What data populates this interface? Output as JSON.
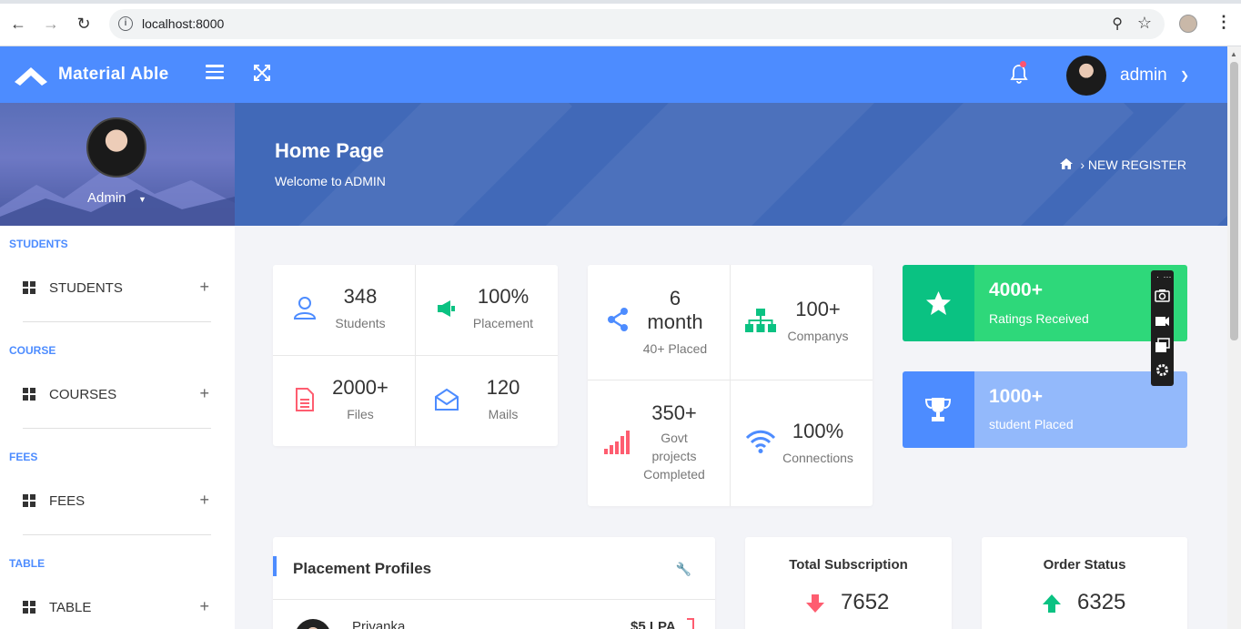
{
  "browser": {
    "url": "localhost:8000",
    "back_icon": "arrow-left-icon",
    "forward_icon": "arrow-right-icon",
    "reload_icon": "reload-icon"
  },
  "header": {
    "brand": "Material Able",
    "user_name": "admin"
  },
  "sidebar": {
    "profile_name": "Admin",
    "sections": [
      {
        "title": "STUDENTS",
        "item": "STUDENTS"
      },
      {
        "title": "COURSE",
        "item": "COURSES"
      },
      {
        "title": "FEES",
        "item": "FEES"
      },
      {
        "title": "TABLE",
        "item": "TABLE"
      }
    ]
  },
  "banner": {
    "title": "Home Page",
    "subtitle": "Welcome to ADMIN",
    "breadcrumb": "NEW REGISTER"
  },
  "stats1": [
    {
      "value": "348",
      "label": "Students",
      "icon": "user-icon",
      "color": "#4d8cff"
    },
    {
      "value": "100%",
      "label": "Placement",
      "icon": "megaphone-icon",
      "color": "#0ac282"
    },
    {
      "value": "2000+",
      "label": "Files",
      "icon": "file-icon",
      "color": "#fe5d70"
    },
    {
      "value": "120",
      "label": "Mails",
      "icon": "envelope-open-icon",
      "color": "#4d8cff"
    }
  ],
  "stats2": [
    {
      "value_line1": "6",
      "value_line2": "month",
      "label": "40+ Placed",
      "icon": "share-icon",
      "color": "#4d8cff"
    },
    {
      "value": "100+",
      "label": "Companys",
      "icon": "sitemap-icon",
      "color": "#0ac282"
    },
    {
      "value": "350+",
      "label_lines": [
        "Govt",
        "projects",
        "Completed"
      ],
      "icon": "signal-bars-icon",
      "color": "#fe5d70"
    },
    {
      "value": "100%",
      "label": "Connections",
      "icon": "wifi-icon",
      "color": "#4d8cff"
    }
  ],
  "highlight_cards": [
    {
      "value": "4000+",
      "label": "Ratings Received",
      "icon": "star-icon",
      "dark": "#0ac282",
      "light": "#2ed87a"
    },
    {
      "value": "1000+",
      "label": "student Placed",
      "icon": "trophy-icon",
      "dark": "#4d8cff",
      "light": "#93b9fb"
    }
  ],
  "placement_profiles": {
    "title": "Placement Profiles",
    "first_row_name": "Privanka",
    "first_row_value": "$5 LPA"
  },
  "total_subscription": {
    "title": "Total Subscription",
    "value": "7652",
    "trend": "down"
  },
  "order_status": {
    "title": "Order Status",
    "value": "6325",
    "trend": "up"
  }
}
